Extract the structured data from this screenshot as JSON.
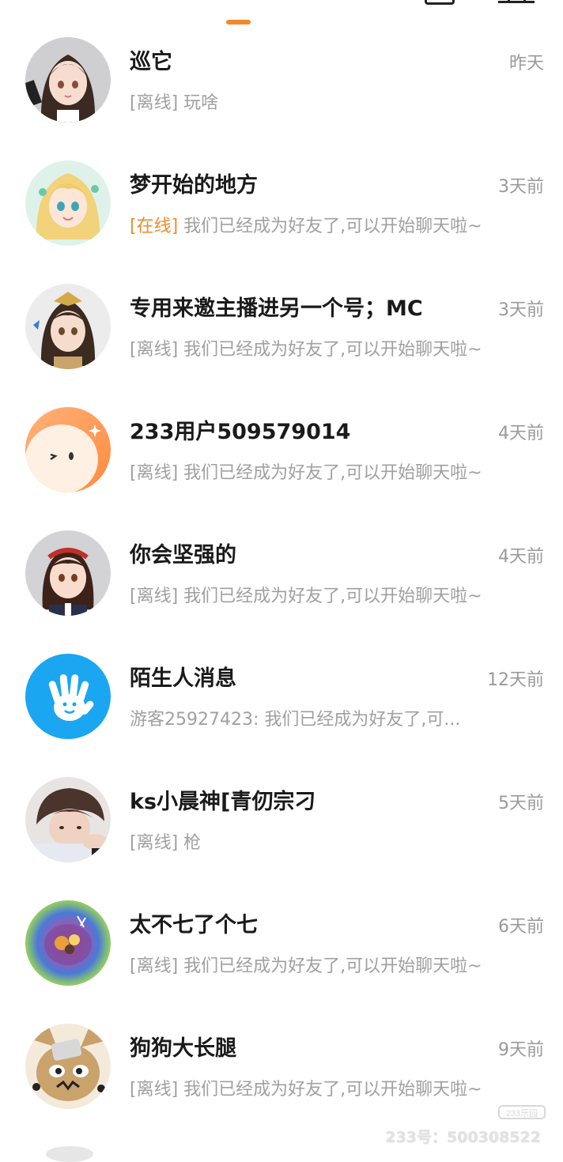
{
  "conversations": [
    {
      "name": "巡它",
      "time": "昨天",
      "status": "[离线]",
      "preview": "玩啥",
      "online": false,
      "avatar_icon": "anime-girl-avatar"
    },
    {
      "name": "梦开始的地方",
      "time": "3天前",
      "status": "[在线]",
      "preview": "我们已经成为好友了,可以开始聊天啦~",
      "online": true,
      "avatar_icon": "anime-blonde-avatar"
    },
    {
      "name": "专用来邀主播进另一个号；MC",
      "time": "3天前",
      "status": "[离线]",
      "preview": "我们已经成为好友了,可以开始聊天啦~",
      "online": false,
      "avatar_icon": "anime-hanfu-avatar"
    },
    {
      "name": "233用户509579014",
      "time": "4天前",
      "status": "[离线]",
      "preview": "我们已经成为好友了,可以开始聊天啦~",
      "online": false,
      "avatar_icon": "orange-blob-avatar"
    },
    {
      "name": "你会坚强的",
      "time": "4天前",
      "status": "[离线]",
      "preview": "我们已经成为好友了,可以开始聊天啦~",
      "online": false,
      "avatar_icon": "anime-headband-avatar"
    },
    {
      "name": "陌生人消息",
      "time": "12天前",
      "status": "",
      "preview": "游客25927423: 我们已经成为好友了,可...",
      "online": false,
      "avatar_icon": "hand-wave-icon"
    },
    {
      "name": "ks小晨神[青仞宗刁",
      "time": "5天前",
      "status": "[离线]",
      "preview": "枪",
      "online": false,
      "avatar_icon": "photo-boy-avatar"
    },
    {
      "name": "太不七了个七",
      "time": "6天前",
      "status": "[离线]",
      "preview": "我们已经成为好友了,可以开始聊天啦~",
      "online": false,
      "avatar_icon": "rainbow-orb-avatar"
    },
    {
      "name": "狗狗大长腿",
      "time": "9天前",
      "status": "[离线]",
      "preview": "我们已经成为好友了,可以开始聊天啦~",
      "online": false,
      "avatar_icon": "cartoon-dog-avatar"
    }
  ],
  "watermark": {
    "logo": "233乐园",
    "id_text": "233号：500308522"
  },
  "colors": {
    "accent": "#f08a2c",
    "name_text": "#1a1a1a",
    "secondary_text": "#a0a0a0"
  }
}
